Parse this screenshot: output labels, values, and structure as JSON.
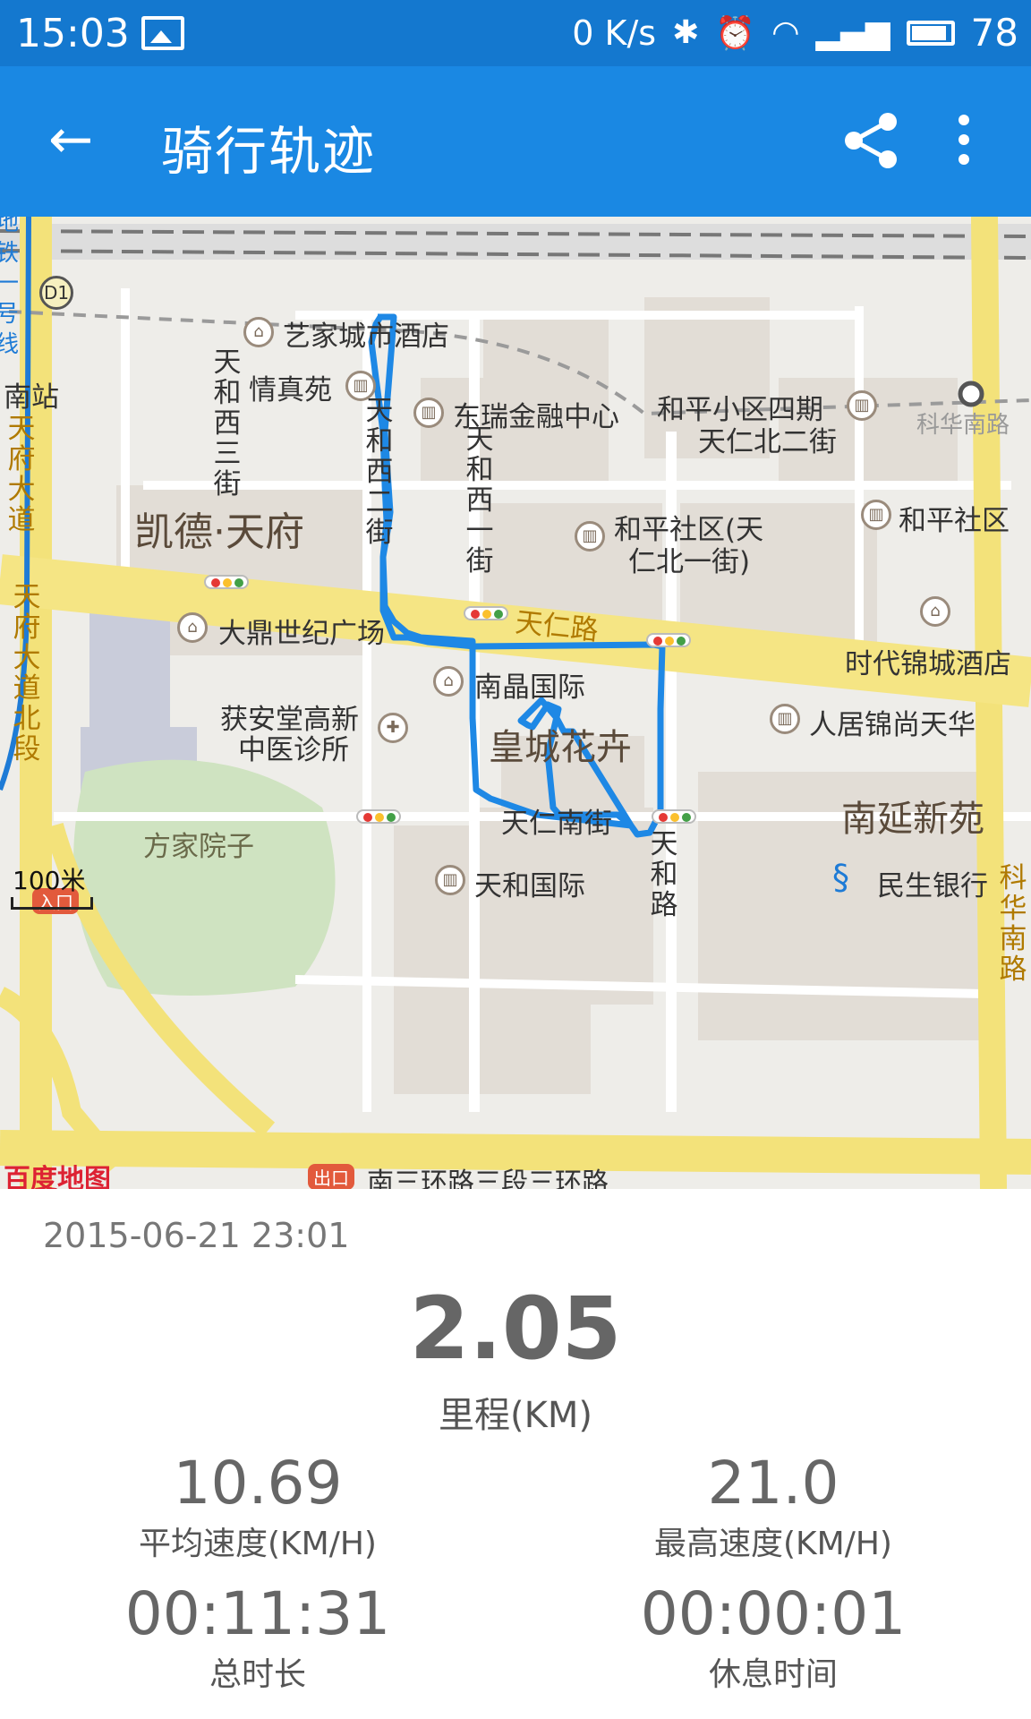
{
  "status_bar": {
    "time": "15:03",
    "net_speed": "0 K/s",
    "battery": "78",
    "icons": [
      "image-icon",
      "bluetooth-icon",
      "alarm-icon",
      "wifi-icon",
      "signal-3g-icon",
      "battery-icon"
    ]
  },
  "app_bar": {
    "title": "骑行轨迹",
    "back_icon": "arrow-left-icon",
    "share_icon": "share-icon",
    "more_icon": "more-vertical-icon"
  },
  "map": {
    "route_color": "#1e88e5",
    "scale": "100米",
    "labels": {
      "yijiacheng": "艺家城市酒店",
      "qingzhen": "情真苑",
      "dongrui": "东瑞金融中心",
      "heping4": "和平小区四期",
      "tianren_n2": "天仁北二街",
      "kaide": "凯德·天府",
      "heping_tian": "和平社区(天",
      "renbei1": "仁北一街)",
      "heping_sq": "和平社区",
      "tianren_lu": "天仁路",
      "dading": "大鼎世纪广场",
      "shidai": "时代锦城酒店",
      "nanjing": "南晶国际",
      "huoan1": "获安堂高新",
      "huoan2": "中医诊所",
      "huangcheng": "皇城花卉",
      "renju": "人居锦尚天华",
      "tianren_nan": "天仁南街",
      "nanyan": "南延新苑",
      "fangjia": "方家院子",
      "tianhe_intl": "天和国际",
      "minsheng": "民生银行",
      "nan_station": "南站",
      "kehua_nan": "科华南路",
      "nansan": "南三环路三段三环路",
      "tianhexi3": "天和西三街",
      "tianhexi2": "天和西二街",
      "tianhexi1": "天和西一街",
      "tianfu": "天府大道",
      "tianfu_bei": "天府大道北段",
      "tianhe_lu": "天和路",
      "kehua_v": "科华南路",
      "ditie": "地铁一号线",
      "d1": "D1",
      "entrance": "入口",
      "exit": "出口",
      "baidu": "百度地图"
    }
  },
  "ride": {
    "date": "2015-06-21 23:01",
    "distance": "2.05",
    "distance_label": "里程(KM)",
    "avg_speed": "10.69",
    "avg_speed_label": "平均速度(KM/H)",
    "max_speed": "21.0",
    "max_speed_label": "最高速度(KM/H)",
    "duration": "00:11:31",
    "duration_label": "总时长",
    "rest": "00:00:01",
    "rest_label": "休息时间"
  }
}
